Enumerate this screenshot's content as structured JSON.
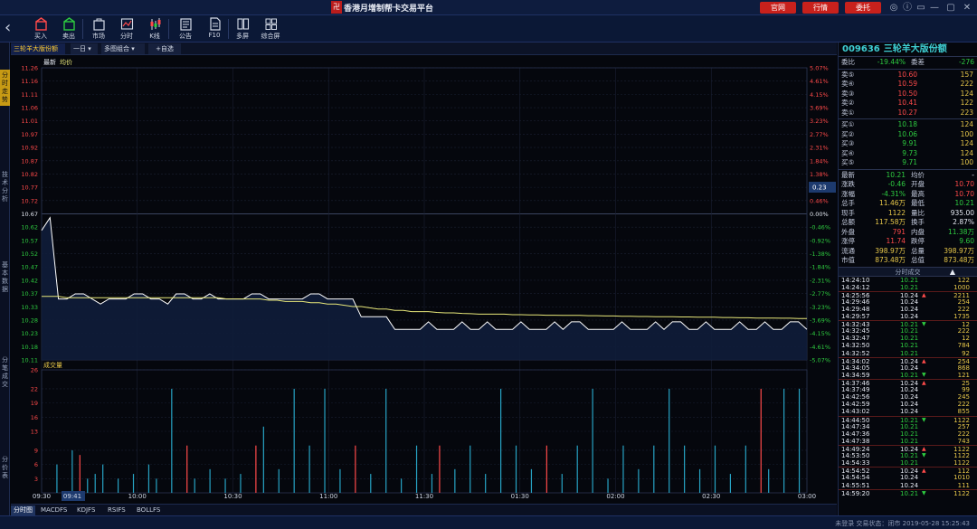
{
  "titlebar": {
    "logo": "卍",
    "title": "香港月增制帮卡交易平台",
    "buttons": [
      "官网",
      "行情",
      "委托"
    ],
    "controls": [
      "◎",
      "ⓘ",
      "▭",
      "—",
      "▢",
      "✕"
    ]
  },
  "toolbar": {
    "back_icon": "chevron-left",
    "items": [
      {
        "label": "买入",
        "icon": "buy-icon",
        "color": "#ff4a4a"
      },
      {
        "label": "卖出",
        "icon": "sell-icon",
        "color": "#2ecc40"
      },
      {
        "label": "市场",
        "icon": "market-icon",
        "color": "#d5dbe8"
      },
      {
        "label": "分时",
        "icon": "timeshare-icon",
        "color": "#d5dbe8"
      },
      {
        "label": "K线",
        "icon": "kline-icon",
        "color": "#ff4a4a"
      },
      {
        "label": "公告",
        "icon": "notice-icon",
        "color": "#d5dbe8"
      },
      {
        "label": "F10",
        "icon": "f10-icon",
        "color": "#d5dbe8"
      },
      {
        "label": "多屏",
        "icon": "multiscreen-icon",
        "color": "#d5dbe8"
      },
      {
        "label": "综合屏",
        "icon": "composite-icon",
        "color": "#d5dbe8"
      }
    ]
  },
  "sidebar": {
    "tabs": [
      "分时走势",
      "技术分析",
      "基本数据",
      "分笔成交",
      "分价表"
    ],
    "active": 0
  },
  "chart_tabs": {
    "stock": "三轮羊大版份额",
    "period": "一日",
    "combo": "多图组合",
    "fav": "+自选",
    "legend_latest": "最新",
    "legend_avg": "均价"
  },
  "chart_data": {
    "type": "line",
    "title": "三轮羊大版份额",
    "prev_close": 10.67,
    "price_ticks": [
      "11.26",
      "11.16",
      "11.11",
      "11.06",
      "11.01",
      "10.97",
      "10.92",
      "10.87",
      "10.82",
      "10.77",
      "10.72",
      "10.67",
      "10.62",
      "10.57",
      "10.52",
      "10.47",
      "10.42",
      "10.37",
      "10.33",
      "10.28",
      "10.23",
      "10.18",
      "10.11"
    ],
    "pct_ticks": [
      "5.07%",
      "4.61%",
      "4.15%",
      "3.69%",
      "3.23%",
      "2.77%",
      "2.31%",
      "1.84%",
      "1.38%",
      "0.92%",
      "0.46%",
      "0.00%",
      "-0.46%",
      "-0.92%",
      "-1.38%",
      "-1.84%",
      "-2.31%",
      "-2.77%",
      "-3.23%",
      "-3.69%",
      "-4.15%",
      "-4.61%",
      "-5.07%"
    ],
    "ylim": [
      10.11,
      11.26
    ],
    "cursor_value": "0.23",
    "x_labels": [
      "09:30",
      "09:41",
      "10:00",
      "10:30",
      "11:00",
      "11:30",
      "01:30",
      "02:00",
      "02:30",
      "03:00"
    ],
    "x_highlight": "09:41",
    "volume_title": "成交量",
    "volume_ticks": [
      "26",
      "22",
      "19",
      "16",
      "13",
      "9",
      "6",
      "3"
    ],
    "volume_ylim": [
      0,
      26
    ],
    "series": [
      {
        "name": "最新",
        "color": "#ffffff",
        "values": [
          10.62,
          10.67,
          10.35,
          10.35,
          10.37,
          10.37,
          10.35,
          10.33,
          10.35,
          10.35,
          10.35,
          10.37,
          10.37,
          10.35,
          10.35,
          10.33,
          10.37,
          10.37,
          10.35,
          10.35,
          10.37,
          10.35,
          10.35,
          10.35,
          10.35,
          10.37,
          10.37,
          10.35,
          10.35,
          10.35,
          10.35,
          10.35,
          10.37,
          10.37,
          10.35,
          10.35,
          10.35,
          10.35,
          10.28,
          10.28,
          10.28,
          10.28,
          10.23,
          10.23,
          10.23,
          10.23,
          10.26,
          10.23,
          10.23,
          10.23,
          10.26,
          10.23,
          10.23,
          10.26,
          10.23,
          10.23,
          10.23,
          10.26,
          10.23,
          10.23,
          10.23,
          10.26,
          10.23,
          10.26,
          10.26,
          10.23,
          10.23,
          10.23,
          10.23,
          10.26,
          10.23,
          10.23,
          10.23,
          10.26,
          10.23,
          10.26,
          10.26,
          10.23,
          10.23,
          10.26,
          10.23,
          10.23,
          10.23,
          10.26,
          10.23,
          10.23,
          10.26,
          10.23,
          10.23,
          10.26,
          10.26,
          10.23
        ]
      },
      {
        "name": "均价",
        "color": "#e8e87a",
        "values": [
          10.36,
          10.36,
          10.36,
          10.355,
          10.355,
          10.355,
          10.355,
          10.355,
          10.355,
          10.355,
          10.355,
          10.355,
          10.355,
          10.355,
          10.355,
          10.355,
          10.355,
          10.355,
          10.355,
          10.355,
          10.355,
          10.355,
          10.35,
          10.35,
          10.35,
          10.35,
          10.35,
          10.345,
          10.345,
          10.34,
          10.34,
          10.34,
          10.335,
          10.335,
          10.33,
          10.33,
          10.325,
          10.32,
          10.32,
          10.315,
          10.31,
          10.31,
          10.305,
          10.305,
          10.3,
          10.3,
          10.3,
          10.297,
          10.295,
          10.295,
          10.293,
          10.292,
          10.29,
          10.29,
          10.29,
          10.29,
          10.288,
          10.288,
          10.287,
          10.287,
          10.286,
          10.286,
          10.285,
          10.285,
          10.285,
          10.284,
          10.284,
          10.283,
          10.283,
          10.282,
          10.282,
          10.281,
          10.281,
          10.28,
          10.28,
          10.28,
          10.279,
          10.279,
          10.278,
          10.278,
          10.278,
          10.277,
          10.277,
          10.276,
          10.276,
          10.275,
          10.275,
          10.275,
          10.274,
          10.274,
          10.273,
          10.273
        ]
      }
    ],
    "volume": [
      {
        "x": 0.02,
        "v": 6,
        "c": "#27a3c4"
      },
      {
        "x": 0.04,
        "v": 9,
        "c": "#27a3c4"
      },
      {
        "x": 0.05,
        "v": 8,
        "c": "#ff4a4a"
      },
      {
        "x": 0.06,
        "v": 3,
        "c": "#27a3c4"
      },
      {
        "x": 0.07,
        "v": 4,
        "c": "#27a3c4"
      },
      {
        "x": 0.08,
        "v": 6,
        "c": "#27a3c4"
      },
      {
        "x": 0.1,
        "v": 3,
        "c": "#27a3c4"
      },
      {
        "x": 0.12,
        "v": 4,
        "c": "#27a3c4"
      },
      {
        "x": 0.14,
        "v": 6,
        "c": "#27a3c4"
      },
      {
        "x": 0.15,
        "v": 3,
        "c": "#27a3c4"
      },
      {
        "x": 0.17,
        "v": 22,
        "c": "#27a3c4"
      },
      {
        "x": 0.19,
        "v": 10,
        "c": "#ff4a4a"
      },
      {
        "x": 0.2,
        "v": 3,
        "c": "#27a3c4"
      },
      {
        "x": 0.22,
        "v": 5,
        "c": "#27a3c4"
      },
      {
        "x": 0.24,
        "v": 3,
        "c": "#27a3c4"
      },
      {
        "x": 0.26,
        "v": 4,
        "c": "#27a3c4"
      },
      {
        "x": 0.28,
        "v": 10,
        "c": "#ff4a4a"
      },
      {
        "x": 0.29,
        "v": 14,
        "c": "#27a3c4"
      },
      {
        "x": 0.31,
        "v": 5,
        "c": "#27a3c4"
      },
      {
        "x": 0.33,
        "v": 22,
        "c": "#27a3c4"
      },
      {
        "x": 0.35,
        "v": 10,
        "c": "#27a3c4"
      },
      {
        "x": 0.37,
        "v": 22,
        "c": "#27a3c4"
      },
      {
        "x": 0.39,
        "v": 5,
        "c": "#27a3c4"
      },
      {
        "x": 0.41,
        "v": 10,
        "c": "#ff4a4a"
      },
      {
        "x": 0.43,
        "v": 4,
        "c": "#27a3c4"
      },
      {
        "x": 0.45,
        "v": 22,
        "c": "#27a3c4"
      },
      {
        "x": 0.47,
        "v": 3,
        "c": "#27a3c4"
      },
      {
        "x": 0.49,
        "v": 10,
        "c": "#27a3c4"
      },
      {
        "x": 0.51,
        "v": 4,
        "c": "#27a3c4"
      },
      {
        "x": 0.52,
        "v": 10,
        "c": "#ff4a4a"
      },
      {
        "x": 0.54,
        "v": 5,
        "c": "#27a3c4"
      },
      {
        "x": 0.56,
        "v": 10,
        "c": "#27a3c4"
      },
      {
        "x": 0.58,
        "v": 4,
        "c": "#27a3c4"
      },
      {
        "x": 0.6,
        "v": 22,
        "c": "#27a3c4"
      },
      {
        "x": 0.62,
        "v": 10,
        "c": "#27a3c4"
      },
      {
        "x": 0.64,
        "v": 5,
        "c": "#27a3c4"
      },
      {
        "x": 0.66,
        "v": 10,
        "c": "#ff4a4a"
      },
      {
        "x": 0.68,
        "v": 4,
        "c": "#27a3c4"
      },
      {
        "x": 0.7,
        "v": 10,
        "c": "#27a3c4"
      },
      {
        "x": 0.72,
        "v": 22,
        "c": "#27a3c4"
      },
      {
        "x": 0.74,
        "v": 3,
        "c": "#27a3c4"
      },
      {
        "x": 0.76,
        "v": 10,
        "c": "#27a3c4"
      },
      {
        "x": 0.78,
        "v": 5,
        "c": "#27a3c4"
      },
      {
        "x": 0.8,
        "v": 10,
        "c": "#27a3c4"
      },
      {
        "x": 0.82,
        "v": 22,
        "c": "#27a3c4"
      },
      {
        "x": 0.84,
        "v": 10,
        "c": "#27a3c4"
      },
      {
        "x": 0.86,
        "v": 5,
        "c": "#27a3c4"
      },
      {
        "x": 0.88,
        "v": 10,
        "c": "#27a3c4"
      },
      {
        "x": 0.9,
        "v": 4,
        "c": "#27a3c4"
      },
      {
        "x": 0.92,
        "v": 10,
        "c": "#27a3c4"
      },
      {
        "x": 0.94,
        "v": 22,
        "c": "#ff4a4a"
      },
      {
        "x": 0.95,
        "v": 5,
        "c": "#27a3c4"
      },
      {
        "x": 0.97,
        "v": 22,
        "c": "#27a3c4"
      },
      {
        "x": 0.99,
        "v": 22,
        "c": "#27a3c4"
      }
    ]
  },
  "bottom_tabs": [
    "分时图",
    "MACDFS",
    "KDJFS",
    "RSIFS",
    "BOLLFS"
  ],
  "statusbar": {
    "text": "未登录 交易状态：闭市 2019-05-28 15:25:43"
  },
  "quote": {
    "code": "009636",
    "name": "三轮羊大版份额",
    "webi_label": "委比",
    "webi_val": "-19.44%",
    "weicha_label": "委差",
    "weicha_val": "-276",
    "asks": [
      {
        "l": "卖⑤",
        "p": "10.60",
        "v": "157"
      },
      {
        "l": "卖④",
        "p": "10.59",
        "v": "222"
      },
      {
        "l": "卖③",
        "p": "10.50",
        "v": "124"
      },
      {
        "l": "卖②",
        "p": "10.41",
        "v": "122"
      },
      {
        "l": "卖①",
        "p": "10.27",
        "v": "223"
      }
    ],
    "bids": [
      {
        "l": "买①",
        "p": "10.18",
        "v": "124"
      },
      {
        "l": "买②",
        "p": "10.06",
        "v": "100"
      },
      {
        "l": "买③",
        "p": "9.91",
        "v": "124"
      },
      {
        "l": "买④",
        "p": "9.73",
        "v": "124"
      },
      {
        "l": "买⑤",
        "p": "9.71",
        "v": "100"
      }
    ],
    "stats": [
      {
        "k1": "最新",
        "v1": "10.21",
        "c1": "g",
        "k2": "均价",
        "v2": "-",
        "c2": "w"
      },
      {
        "k1": "涨跌",
        "v1": "-0.46",
        "c1": "g",
        "k2": "开盘",
        "v2": "10.70",
        "c2": "r"
      },
      {
        "k1": "涨幅",
        "v1": "-4.31%",
        "c1": "g",
        "k2": "最高",
        "v2": "10.70",
        "c2": "r"
      },
      {
        "k1": "总手",
        "v1": "11.46万",
        "c1": "y",
        "k2": "最低",
        "v2": "10.21",
        "c2": "g"
      },
      {
        "k1": "现手",
        "v1": "1122",
        "c1": "y",
        "k2": "量比",
        "v2": "935.00",
        "c2": "w"
      },
      {
        "k1": "总额",
        "v1": "117.58万",
        "c1": "y",
        "k2": "换手",
        "v2": "2.87%",
        "c2": "w"
      },
      {
        "k1": "外盘",
        "v1": "791",
        "c1": "r",
        "k2": "内盘",
        "v2": "11.38万",
        "c2": "g"
      },
      {
        "k1": "涨停",
        "v1": "11.74",
        "c1": "r",
        "k2": "跌停",
        "v2": "9.60",
        "c2": "g"
      },
      {
        "k1": "流通",
        "v1": "398.97万",
        "c1": "y",
        "k2": "总量",
        "v2": "398.97万",
        "c2": "y"
      },
      {
        "k1": "市值",
        "v1": "873.48万",
        "c1": "y",
        "k2": "总值",
        "v2": "873.48万",
        "c2": "y"
      }
    ],
    "ticks_title": "分时成交",
    "ticks": [
      {
        "t": "14:24:10",
        "p": "10.21",
        "d": "",
        "v": "122",
        "c": "g"
      },
      {
        "t": "14:24:12",
        "p": "10.21",
        "d": "",
        "v": "1000",
        "c": "g"
      },
      {
        "t": "14:25:56",
        "p": "10.24",
        "d": "▲",
        "v": "2211",
        "c": "g",
        "s": 1
      },
      {
        "t": "14:29:46",
        "p": "10.24",
        "d": "",
        "v": "254",
        "c": "g"
      },
      {
        "t": "14:29:48",
        "p": "10.24",
        "d": "",
        "v": "222",
        "c": "g"
      },
      {
        "t": "14:29:57",
        "p": "10.24",
        "d": "",
        "v": "1735",
        "c": "g"
      },
      {
        "t": "14:32:43",
        "p": "10.21",
        "d": "▼",
        "v": "12",
        "c": "g",
        "s": 1
      },
      {
        "t": "14:32:45",
        "p": "10.21",
        "d": "",
        "v": "222",
        "c": "g"
      },
      {
        "t": "14:32:47",
        "p": "10.21",
        "d": "",
        "v": "12",
        "c": "g"
      },
      {
        "t": "14:32:50",
        "p": "10.21",
        "d": "",
        "v": "784",
        "c": "g"
      },
      {
        "t": "14:32:52",
        "p": "10.21",
        "d": "",
        "v": "92",
        "c": "g"
      },
      {
        "t": "14:34:02",
        "p": "10.24",
        "d": "▲",
        "v": "254",
        "c": "g",
        "s": 1
      },
      {
        "t": "14:34:05",
        "p": "10.24",
        "d": "",
        "v": "868",
        "c": "g"
      },
      {
        "t": "14:34:59",
        "p": "10.21",
        "d": "▼",
        "v": "121",
        "c": "g"
      },
      {
        "t": "14:37:46",
        "p": "10.24",
        "d": "▲",
        "v": "25",
        "c": "g",
        "s": 1
      },
      {
        "t": "14:37:49",
        "p": "10.24",
        "d": "",
        "v": "99",
        "c": "g"
      },
      {
        "t": "14:42:56",
        "p": "10.24",
        "d": "",
        "v": "245",
        "c": "g"
      },
      {
        "t": "14:42:59",
        "p": "10.24",
        "d": "",
        "v": "222",
        "c": "g"
      },
      {
        "t": "14:43:02",
        "p": "10.24",
        "d": "",
        "v": "855",
        "c": "g"
      },
      {
        "t": "14:44:50",
        "p": "10.21",
        "d": "▼",
        "v": "1122",
        "c": "g",
        "s": 1
      },
      {
        "t": "14:47:34",
        "p": "10.21",
        "d": "",
        "v": "257",
        "c": "g"
      },
      {
        "t": "14:47:36",
        "p": "10.21",
        "d": "",
        "v": "222",
        "c": "g"
      },
      {
        "t": "14:47:38",
        "p": "10.21",
        "d": "",
        "v": "743",
        "c": "g"
      },
      {
        "t": "14:49:24",
        "p": "10.24",
        "d": "▲",
        "v": "1122",
        "c": "g",
        "s": 1
      },
      {
        "t": "14:53:50",
        "p": "10.21",
        "d": "▼",
        "v": "1122",
        "c": "g"
      },
      {
        "t": "14:54:33",
        "p": "10.21",
        "d": "",
        "v": "1122",
        "c": "g"
      },
      {
        "t": "14:54:52",
        "p": "10.24",
        "d": "▲",
        "v": "112",
        "c": "g",
        "s": 1
      },
      {
        "t": "14:54:54",
        "p": "10.24",
        "d": "",
        "v": "1010",
        "c": "g"
      },
      {
        "t": "14:55:51",
        "p": "10.24",
        "d": "",
        "v": "111",
        "c": "g"
      },
      {
        "t": "14:59:20",
        "p": "10.21",
        "d": "▼",
        "v": "1122",
        "c": "g",
        "s": 1
      }
    ]
  }
}
